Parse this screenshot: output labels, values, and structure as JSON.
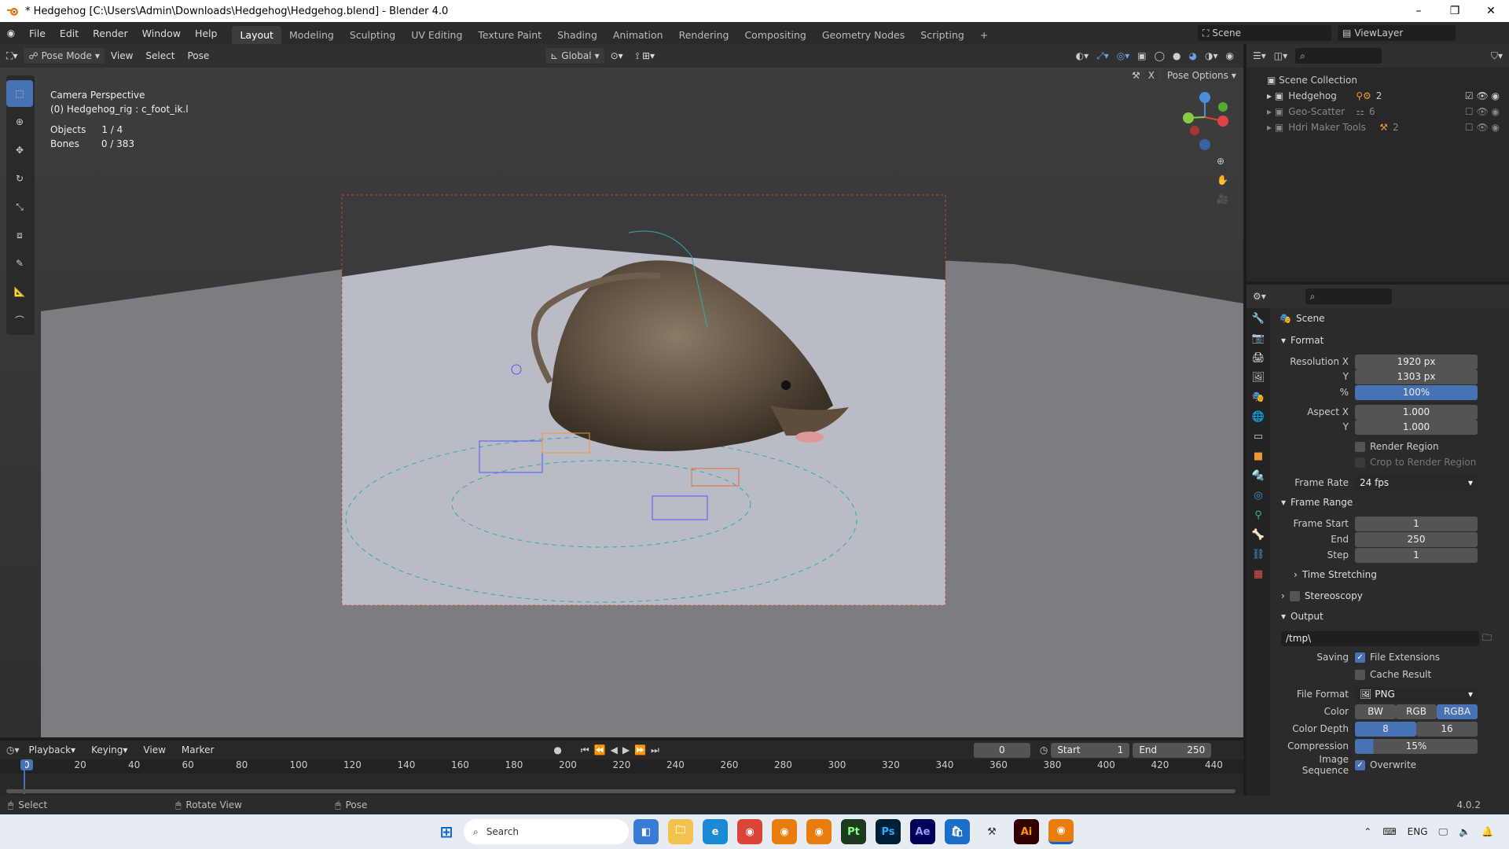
{
  "window": {
    "title": "* Hedgehog [C:\\Users\\Admin\\Downloads\\Hedgehog\\Hedgehog.blend] - Blender 4.0"
  },
  "menu": {
    "items": [
      "File",
      "Edit",
      "Render",
      "Window",
      "Help"
    ]
  },
  "workspaces": [
    "Layout",
    "Modeling",
    "Sculpting",
    "UV Editing",
    "Texture Paint",
    "Shading",
    "Animation",
    "Rendering",
    "Compositing",
    "Geometry Nodes",
    "Scripting"
  ],
  "scene_selector": "Scene",
  "viewlayer_selector": "ViewLayer",
  "viewport_header": {
    "mode": "Pose Mode",
    "view": "View",
    "select": "Select",
    "pose": "Pose",
    "transform": "Global",
    "pose_options": "Pose Options"
  },
  "viewport_info": {
    "line1": "Camera Perspective",
    "line2": "(0) Hedgehog_rig : c_foot_ik.l",
    "objects_label": "Objects",
    "objects_value": "1 / 4",
    "bones_label": "Bones",
    "bones_value": "0 / 383"
  },
  "outliner": {
    "root": "Scene Collection",
    "items": [
      {
        "name": "Hedgehog",
        "badge": "2"
      },
      {
        "name": "Geo-Scatter",
        "badge": "6"
      },
      {
        "name": "Hdri Maker Tools",
        "badge": "2"
      }
    ]
  },
  "properties": {
    "breadcrumb": "Scene",
    "format": {
      "title": "Format",
      "res_x_label": "Resolution X",
      "res_x": "1920 px",
      "res_y_label": "Y",
      "res_y": "1303 px",
      "pct_label": "%",
      "pct": "100%",
      "aspect_x_label": "Aspect X",
      "aspect_x": "1.000",
      "aspect_y_label": "Y",
      "aspect_y": "1.000",
      "render_region": "Render Region",
      "crop": "Crop to Render Region",
      "frame_rate_label": "Frame Rate",
      "frame_rate": "24 fps"
    },
    "frame_range": {
      "title": "Frame Range",
      "start_label": "Frame Start",
      "start": "1",
      "end_label": "End",
      "end": "250",
      "step_label": "Step",
      "step": "1",
      "time_stretching": "Time Stretching"
    },
    "stereoscopy": "Stereoscopy",
    "output": {
      "title": "Output",
      "path": "/tmp\\",
      "saving_label": "Saving",
      "file_ext": "File Extensions",
      "cache": "Cache Result",
      "file_format_label": "File Format",
      "file_format": "PNG",
      "color_label": "Color",
      "color_opts": [
        "BW",
        "RGB",
        "RGBA"
      ],
      "depth_label": "Color Depth",
      "depth_opts": [
        "8",
        "16"
      ],
      "compression_label": "Compression",
      "compression": "15%",
      "image_seq_label": "Image Sequence",
      "overwrite": "Overwrite"
    }
  },
  "timeline": {
    "playback": "Playback",
    "keying": "Keying",
    "view": "View",
    "marker": "Marker",
    "current": "0",
    "start_label": "Start",
    "start": "1",
    "end_label": "End",
    "end": "250",
    "ticks": [
      "0",
      "20",
      "40",
      "60",
      "80",
      "100",
      "120",
      "140",
      "160",
      "180",
      "200",
      "220",
      "240",
      "260",
      "280",
      "300",
      "320",
      "340",
      "360",
      "380",
      "400",
      "420",
      "440"
    ]
  },
  "statusbar": {
    "select": "Select",
    "rotate": "Rotate View",
    "pose": "Pose",
    "version": "4.0.2"
  },
  "taskbar": {
    "search": "Search",
    "lang": "ENG"
  }
}
